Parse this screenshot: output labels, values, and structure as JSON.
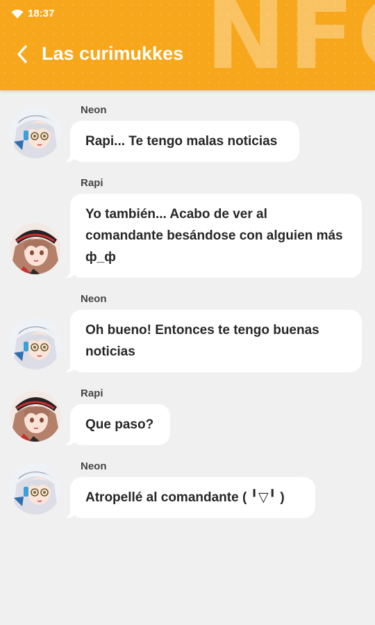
{
  "status_bar": {
    "time": "18:37",
    "wifi_icon": "wifi-icon"
  },
  "header": {
    "title": "Las curimukkes",
    "back_icon": "chevron-left-icon",
    "watermark": "NFG",
    "background_color": "#f7a71b"
  },
  "messages": [
    {
      "sender": "Neon",
      "text": "Rapi... Te tengo malas noticias"
    },
    {
      "sender": "Rapi",
      "text": "Yo también... Acabo de ver al comandante besándose con alguien más ф_ф"
    },
    {
      "sender": "Neon",
      "text": "Oh bueno! Entonces te tengo buenas noticias"
    },
    {
      "sender": "Rapi",
      "text": "Que paso?"
    },
    {
      "sender": "Neon",
      "text": "Atropellé al comandante ( ╹▽╹ )"
    }
  ]
}
